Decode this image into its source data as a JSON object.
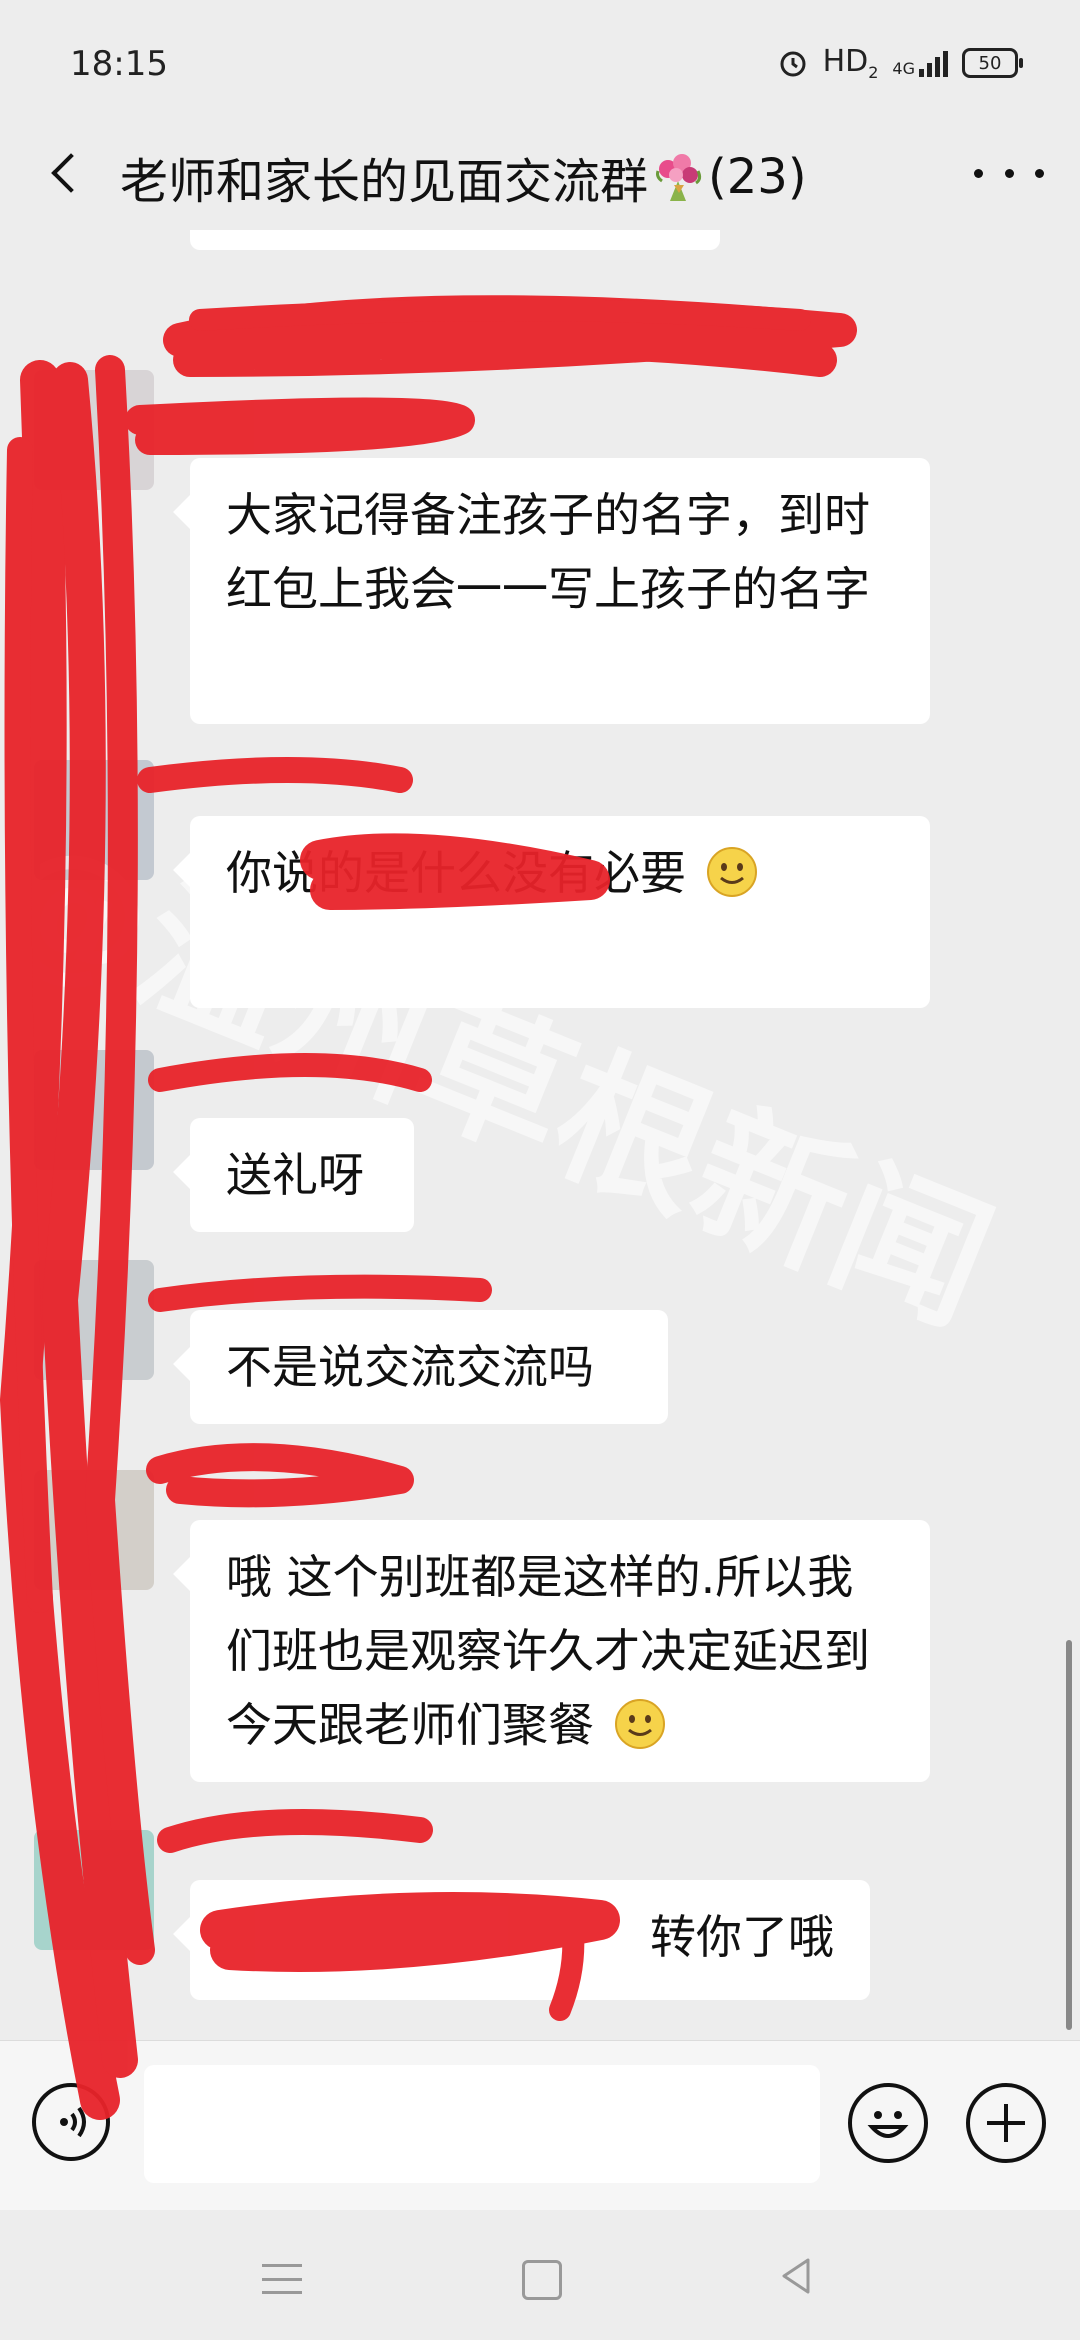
{
  "status_bar": {
    "time": "18:15",
    "network_label": "HD",
    "network_sub": "2",
    "signal_label": "4G",
    "battery": "50"
  },
  "header": {
    "title_text": "老师和家长的见面交流群",
    "member_count": "(23)"
  },
  "messages": [
    {
      "text": "大家记得备注孩子的名字，到时红包上我会一一写上孩子的名字"
    },
    {
      "text": "你说的是什么没有必要",
      "has_emoji": true
    },
    {
      "text": "送礼呀"
    },
    {
      "text": "不是说交流交流吗"
    },
    {
      "text": "哦 这个别班都是这样的.所以我们班也是观察许久才决定延迟到今天跟老师们聚餐",
      "has_emoji": true
    },
    {
      "text": "转你了哦"
    }
  ],
  "watermark": "@温州草根新闻",
  "input": {
    "placeholder": ""
  },
  "colors": {
    "redaction": "#e8232a",
    "background": "#ededed",
    "bubble": "#ffffff"
  },
  "icons": [
    "back-arrow-icon",
    "bouquet-icon",
    "more-icon",
    "voice-icon",
    "emoji-icon",
    "plus-icon",
    "menu-icon",
    "home-icon",
    "back-triangle-icon"
  ]
}
